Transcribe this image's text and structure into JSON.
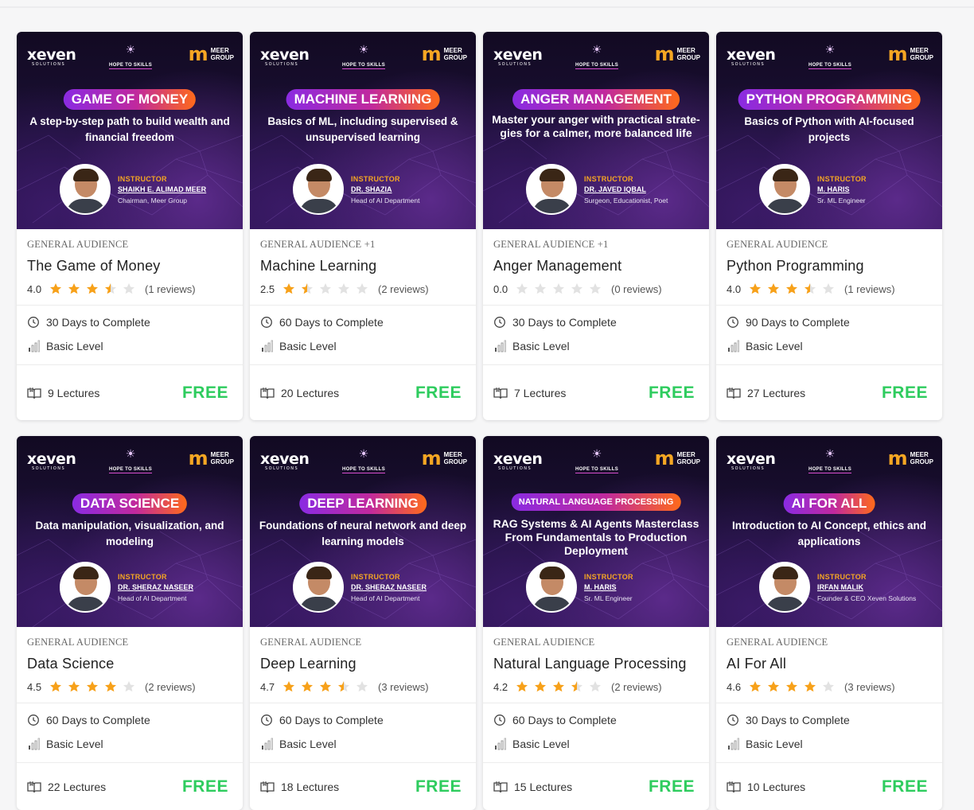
{
  "brand": {
    "xeven": "xeven",
    "xeven_sub": "SOLUTIONS",
    "hts": "HOPE TO SKILLS",
    "meer_line1": "MEER",
    "meer_line2": "GROUP"
  },
  "labels": {
    "instructor": "INSTRUCTOR"
  },
  "colors": {
    "free_green": "#2ecc5e",
    "star_orange": "#f7a11a",
    "star_empty": "#e2e2e2",
    "instructor_orange": "#f5a623"
  },
  "courses": [
    {
      "banner_title": "GAME OF MONEY",
      "banner_subtitle": "A step-by-step path to build wealth and financial freedom",
      "instructor_name": "SHAIKH E. ALIMAD MEER",
      "instructor_role": "Chairman, Meer Group",
      "audience": "GENERAL AUDIENCE",
      "title": "The Game of Money",
      "rating": "4.0",
      "stars": 3.5,
      "reviews": "(1 reviews)",
      "duration": "30 Days to Complete",
      "level": "Basic Level",
      "lectures": "9 Lectures",
      "price": "FREE"
    },
    {
      "banner_title": "MACHINE LEARNING",
      "banner_subtitle": "Basics of ML, including supervised & unsupervised learning",
      "instructor_name": "DR. SHAZIA",
      "instructor_role": "Head of AI Department",
      "audience": "GENERAL AUDIENCE +1",
      "title": "Machine Learning",
      "rating": "2.5",
      "stars": 1.5,
      "reviews": "(2 reviews)",
      "duration": "60 Days to Complete",
      "level": "Basic Level",
      "lectures": "20 Lectures",
      "price": "FREE"
    },
    {
      "banner_title": "ANGER MANAGEMENT",
      "banner_subtitle": "Master your anger with practical strate-gies for a calmer, more balanced life",
      "instructor_name": "DR. JAVED IQBAL",
      "instructor_role": "Surgeon, Educationist, Poet",
      "audience": "GENERAL AUDIENCE +1",
      "title": "Anger Management",
      "rating": "0.0",
      "stars": 0,
      "reviews": "(0 reviews)",
      "duration": "30 Days to Complete",
      "level": "Basic Level",
      "lectures": "7 Lectures",
      "price": "FREE"
    },
    {
      "banner_title": "PYTHON PROGRAMMING",
      "banner_subtitle": "Basics of Python with AI-focused projects",
      "instructor_name": "M. HARIS",
      "instructor_role": "Sr. ML Engineer",
      "audience": "GENERAL AUDIENCE",
      "title": "Python Programming",
      "rating": "4.0",
      "stars": 3.5,
      "reviews": "(1 reviews)",
      "duration": "90 Days to Complete",
      "level": "Basic Level",
      "lectures": "27 Lectures",
      "price": "FREE"
    },
    {
      "banner_title": "DATA SCIENCE",
      "banner_subtitle": "Data manipulation, visualization, and modeling",
      "instructor_name": "DR. SHERAZ NASEER",
      "instructor_role": "Head of AI Department",
      "audience": "GENERAL AUDIENCE",
      "title": "Data Science",
      "rating": "4.5",
      "stars": 4,
      "reviews": "(2 reviews)",
      "duration": "60 Days to Complete",
      "level": "Basic Level",
      "lectures": "22 Lectures",
      "price": "FREE"
    },
    {
      "banner_title": "DEEP LEARNING",
      "banner_subtitle": "Foundations of neural network and deep learning models",
      "instructor_name": "DR. SHERAZ NASEER",
      "instructor_role": "Head of AI Department",
      "audience": "GENERAL AUDIENCE",
      "title": "Deep Learning",
      "rating": "4.7",
      "stars": 3.5,
      "reviews": "(3 reviews)",
      "duration": "60 Days to Complete",
      "level": "Basic Level",
      "lectures": "18 Lectures",
      "price": "FREE"
    },
    {
      "banner_title": "NATURAL LANGUAGE PROCESSING",
      "banner_subtitle": "RAG Systems & AI Agents Masterclass From Fundamentals to Production Deployment",
      "instructor_name": "M. HARIS",
      "instructor_role": "Sr. ML Engineer",
      "audience": "GENERAL AUDIENCE",
      "title": "Natural Language Processing",
      "rating": "4.2",
      "stars": 3.5,
      "reviews": "(2 reviews)",
      "duration": "60 Days to Complete",
      "level": "Basic Level",
      "lectures": "15 Lectures",
      "price": "FREE"
    },
    {
      "banner_title": "AI FOR ALL",
      "banner_subtitle": "Introduction to AI Concept, ethics and applications",
      "instructor_name": "IRFAN MALIK",
      "instructor_role": "Founder & CEO Xeven Solutions",
      "audience": "GENERAL AUDIENCE",
      "title": "AI For All",
      "rating": "4.6",
      "stars": 4,
      "reviews": "(3 reviews)",
      "duration": "30 Days to Complete",
      "level": "Basic Level",
      "lectures": "10 Lectures",
      "price": "FREE"
    }
  ]
}
